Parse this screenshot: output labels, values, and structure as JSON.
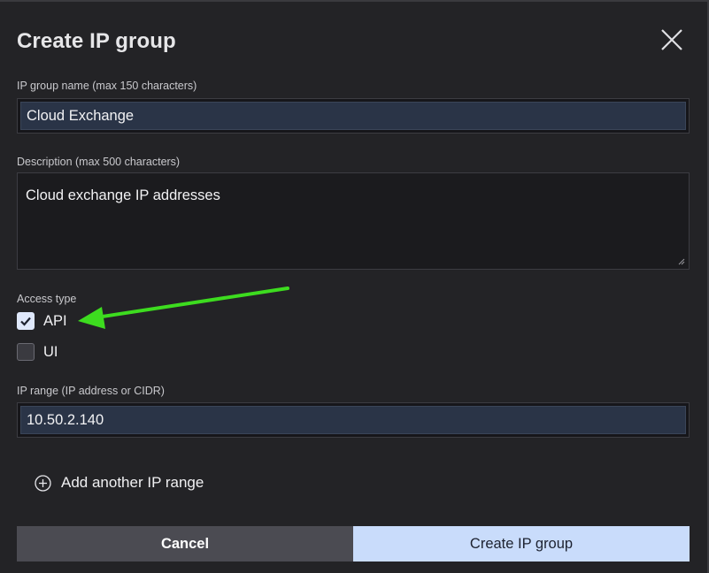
{
  "dialog": {
    "title": "Create IP group",
    "close_icon": "close-icon"
  },
  "name_field": {
    "label": "IP group name (max 150 characters)",
    "value": "Cloud Exchange"
  },
  "description_field": {
    "label": "Description (max 500 characters)",
    "value": "Cloud exchange IP addresses"
  },
  "access_type": {
    "label": "Access type",
    "options": [
      {
        "label": "API",
        "checked": true
      },
      {
        "label": "UI",
        "checked": false
      }
    ]
  },
  "ip_range_field": {
    "label": "IP range (IP address or CIDR)",
    "value": "10.50.2.140"
  },
  "add_range": {
    "icon": "plus-circle-icon",
    "label": "Add another IP range"
  },
  "footer": {
    "cancel_label": "Cancel",
    "create_label": "Create IP group"
  },
  "colors": {
    "dialog_bg": "#232326",
    "input_bg": "#2a3447",
    "primary_button": "#c9dcfb",
    "secondary_button": "#4b4b52",
    "annotation_arrow": "#3ddc1f"
  }
}
